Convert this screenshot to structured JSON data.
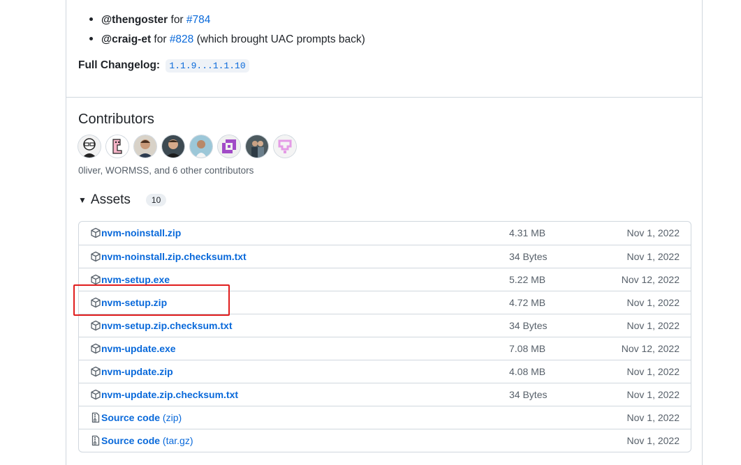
{
  "credits": [
    {
      "user": "@thengoster",
      "mid": " for ",
      "pr": "#784",
      "tail": ""
    },
    {
      "user": "@craig-et",
      "mid": " for ",
      "pr": "#828",
      "tail": " (which brought UAC prompts back)"
    }
  ],
  "changelog": {
    "label": "Full Changelog:",
    "range": "1.1.9...1.1.10"
  },
  "contributors": {
    "title": "Contributors",
    "summary": "0liver, WORMSS, and 6 other contributors"
  },
  "assets": {
    "title": "Assets",
    "count": "10",
    "rows": [
      {
        "name": "nvm-noinstall.zip",
        "ext": "",
        "size": "4.31 MB",
        "date": "Nov 1, 2022",
        "icon": "package-icon"
      },
      {
        "name": "nvm-noinstall.zip.checksum.txt",
        "ext": "",
        "size": "34 Bytes",
        "date": "Nov 1, 2022",
        "icon": "package-icon"
      },
      {
        "name": "nvm-setup.exe",
        "ext": "",
        "size": "5.22 MB",
        "date": "Nov 12, 2022",
        "icon": "package-icon"
      },
      {
        "name": "nvm-setup.zip",
        "ext": "",
        "size": "4.72 MB",
        "date": "Nov 1, 2022",
        "icon": "package-icon"
      },
      {
        "name": "nvm-setup.zip.checksum.txt",
        "ext": "",
        "size": "34 Bytes",
        "date": "Nov 1, 2022",
        "icon": "package-icon"
      },
      {
        "name": "nvm-update.exe",
        "ext": "",
        "size": "7.08 MB",
        "date": "Nov 12, 2022",
        "icon": "package-icon"
      },
      {
        "name": "nvm-update.zip",
        "ext": "",
        "size": "4.08 MB",
        "date": "Nov 1, 2022",
        "icon": "package-icon"
      },
      {
        "name": "nvm-update.zip.checksum.txt",
        "ext": "",
        "size": "34 Bytes",
        "date": "Nov 1, 2022",
        "icon": "package-icon"
      },
      {
        "name": "Source code",
        "ext": " (zip)",
        "size": "",
        "date": "Nov 1, 2022",
        "icon": "file-zip-icon"
      },
      {
        "name": "Source code",
        "ext": " (tar.gz)",
        "size": "",
        "date": "Nov 1, 2022",
        "icon": "file-zip-icon"
      }
    ]
  },
  "colors": {
    "link": "#0969da",
    "highlight": "#e01d1d",
    "border": "#d0d7de"
  }
}
